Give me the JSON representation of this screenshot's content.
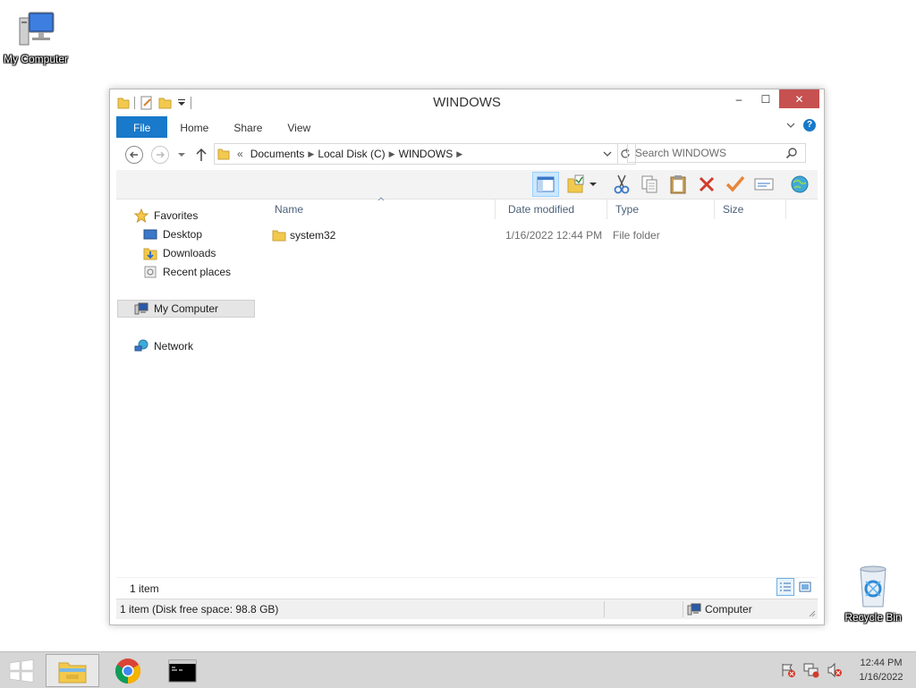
{
  "desktop": {
    "icons": [
      {
        "label": "My Computer"
      },
      {
        "label": "Recycle Bin"
      }
    ]
  },
  "window": {
    "title": "WINDOWS",
    "controls": {
      "minimize": "–",
      "maximize": "☐",
      "close": "✕"
    },
    "ribbon": {
      "tabs": [
        "File",
        "Home",
        "Share",
        "View"
      ],
      "help": "?"
    },
    "address": {
      "overflow": "«",
      "crumbs": [
        "Documents",
        "Local Disk (C)",
        "WINDOWS"
      ],
      "search_placeholder": "Search WINDOWS"
    },
    "nav_pane": {
      "favorites": "Favorites",
      "favorites_items": [
        "Desktop",
        "Downloads",
        "Recent places"
      ],
      "my_computer": "My Computer",
      "network": "Network"
    },
    "columns": [
      "Name",
      "Date modified",
      "Type",
      "Size"
    ],
    "files": [
      {
        "name": "system32",
        "date": "1/16/2022 12:44 PM",
        "type": "File folder",
        "size": ""
      }
    ],
    "status": {
      "item_count": "1 item",
      "detail": "1 item (Disk free space: 98.8 GB)",
      "location": "Computer"
    }
  },
  "taskbar": {
    "time": "12:44 PM",
    "date": "1/16/2022"
  },
  "colors": {
    "accent": "#1979ca",
    "close_button": "#c75050",
    "selection": "#cce8ff"
  }
}
